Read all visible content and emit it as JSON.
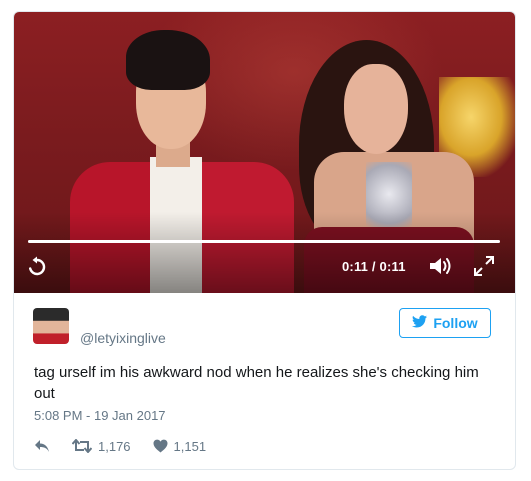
{
  "video": {
    "time_display": "0:11 / 0:11",
    "progress": 1.0,
    "controls": {
      "replay_icon": "replay-icon",
      "volume_icon": "volume-icon",
      "expand_icon": "expand-icon"
    }
  },
  "tweet": {
    "handle": "@letyixinglive",
    "follow_label": "Follow",
    "text": "tag urself im his awkward nod when he realizes she's checking him out",
    "timestamp": "5:08 PM - 19 Jan 2017",
    "retweets": "1,176",
    "likes": "1,151"
  },
  "colors": {
    "accent": "#1da1f2",
    "muted": "#657786",
    "text": "#14171a",
    "border": "#e1e8ed"
  }
}
